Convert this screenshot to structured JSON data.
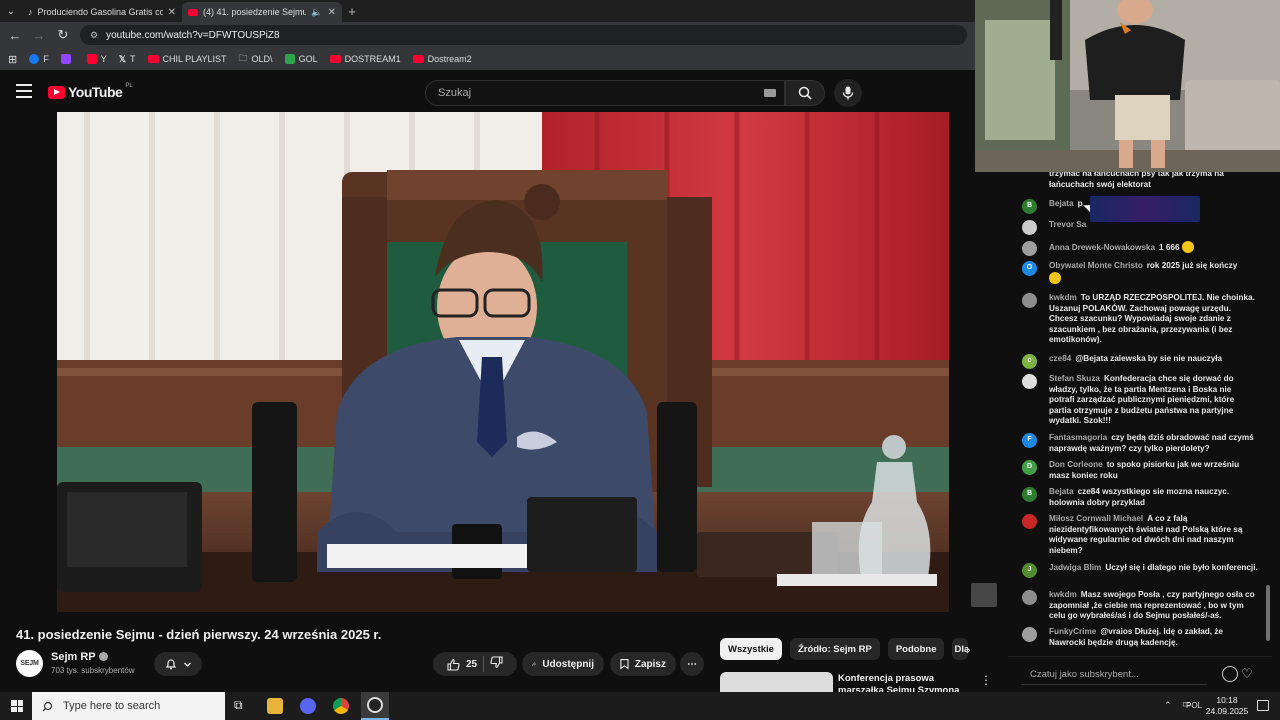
{
  "browser": {
    "tabs": [
      {
        "label": "Produciendo Gasolina Gratis con",
        "active": false
      },
      {
        "label": "(4) 41. posiedzenie Sejmu -",
        "active": true
      }
    ],
    "url": "youtube.com/watch?v=DFWTOUSPiZ8",
    "bookmarks": [
      {
        "label": "F",
        "color": "#1877f2"
      },
      {
        "label": "",
        "color": "#9146ff"
      },
      {
        "label": "Y",
        "color": "#ff0033"
      },
      {
        "label": "T",
        "color": "#444444"
      },
      {
        "label": "CHIL PLAYLIST",
        "color": "#ff0033"
      },
      {
        "label": "OLD\\",
        "color": "#888888"
      },
      {
        "label": "GOL",
        "color": "#2ea44f"
      },
      {
        "label": "DOSTREAM1",
        "color": "#ff0033"
      },
      {
        "label": "Dostream2",
        "color": "#ff0033"
      }
    ]
  },
  "youtube": {
    "logo_text": "YouTube",
    "country_code": "PL",
    "search_placeholder": "Szukaj"
  },
  "video": {
    "title": "41. posiedzenie Sejmu - dzień pierwszy. 24 września 2025 r.",
    "channel_name": "Sejm RP",
    "channel_avatar_text": "SEJM",
    "subscribers": "703 tys. subskrybentów",
    "likes": "25",
    "share_label": "Udostępnij",
    "save_label": "Zapisz"
  },
  "chips": [
    "Wszystkie",
    "Źródło: Sejm RP",
    "Podobne",
    "Dla"
  ],
  "recommendation": {
    "title": "Konferencja prasowa marszałka Sejmu Szymona Hołowni"
  },
  "chat": {
    "input_placeholder": "Czatuj jako subskrybent...",
    "messages": [
      {
        "author": "",
        "text": "trzymać na łańcuchach psy tak jak trzyma na łańcuchach swój elektorat",
        "avatar": "",
        "avatar_color": "#0f0f0f"
      },
      {
        "author": "Bejata",
        "text": "p",
        "avatar": "B",
        "avatar_color": "#2e7d32"
      },
      {
        "author": "Trevor Sa",
        "text": "",
        "avatar": "",
        "avatar_color": "#cccccc"
      },
      {
        "author": "Anna Drewek-Nowakowska",
        "text": "1 666",
        "avatar": "",
        "avatar_color": "#9e9e9e"
      },
      {
        "author": "Obywatel Monte Christo",
        "text": "rok 2025 już się kończy",
        "avatar": "O",
        "avatar_color": "#1e88e5"
      },
      {
        "author": "kwkdm",
        "text": "To URZĄD RZECZPOSPOLITEJ. Nie choinka. Uszanuj POLAKÓW. Zachowaj powagę urzędu. Chcesz szacunku? Wypowiadaj swoje zdanie z szacunkiem , bez obrażania, przezywania (i bez emotikonów).",
        "avatar": "",
        "avatar_color": "#8d8d8d"
      },
      {
        "author": "cze84",
        "text": "@Bejata zalewska by sie nie nauczyła",
        "avatar": "c",
        "avatar_color": "#7cb342"
      },
      {
        "author": "Stefan Skuza",
        "text": "Konfederacja chce się dorwać do władzy, tylko, że ta partia Mentzena i Boska nie potrafi zarządzać publicznymi pieniędzmi, które partia otrzymuje z budżetu państwa na partyjne wydatki. Szok!!!",
        "avatar": "",
        "avatar_color": "#dddddd"
      },
      {
        "author": "Fantasmagoria",
        "text": "czy będą dziś obradować nad czymś naprawdę ważnym? czy tylko pierdolety?",
        "avatar": "F",
        "avatar_color": "#1e88e5"
      },
      {
        "author": "Don Corleone",
        "text": "to spoko pisiorku jak we wrześniu masz koniec roku",
        "avatar": "D",
        "avatar_color": "#43a047"
      },
      {
        "author": "Bejata",
        "text": "cze84 wszystkiego sie mozna nauczyc. holownia dobry przyklad",
        "avatar": "B",
        "avatar_color": "#2e7d32"
      },
      {
        "author": "Miłosz Cornwall Michael",
        "text": "A co z falą niezidentyfikowanych świateł nad Polską które są widywane regularnie od dwóch dni nad naszym niebem?",
        "avatar": "",
        "avatar_color": "#c62828"
      },
      {
        "author": "Jadwiga Blim",
        "text": "Uczył się i dlatego nie było konferencji.",
        "avatar": "J",
        "avatar_color": "#558b2f"
      },
      {
        "author": "kwkdm",
        "text": "Masz swojego Posła , czy partyjnego osła co zapomniał ,że ciebie ma reprezentować , bo w tym celu go wybrałeś/aś i do Sejmu posłałeś/-aś.",
        "avatar": "",
        "avatar_color": "#8d8d8d"
      },
      {
        "author": "FunkyCrime",
        "text": "@vraios Dłużej. Idę o zakład, że Nawrocki będzie drugą kadencję.",
        "avatar": "",
        "avatar_color": "#9e9e9e"
      }
    ]
  },
  "taskbar": {
    "search_placeholder": "Type here to search",
    "language": "POL",
    "time": "10:18",
    "date": "24.09.2025"
  }
}
